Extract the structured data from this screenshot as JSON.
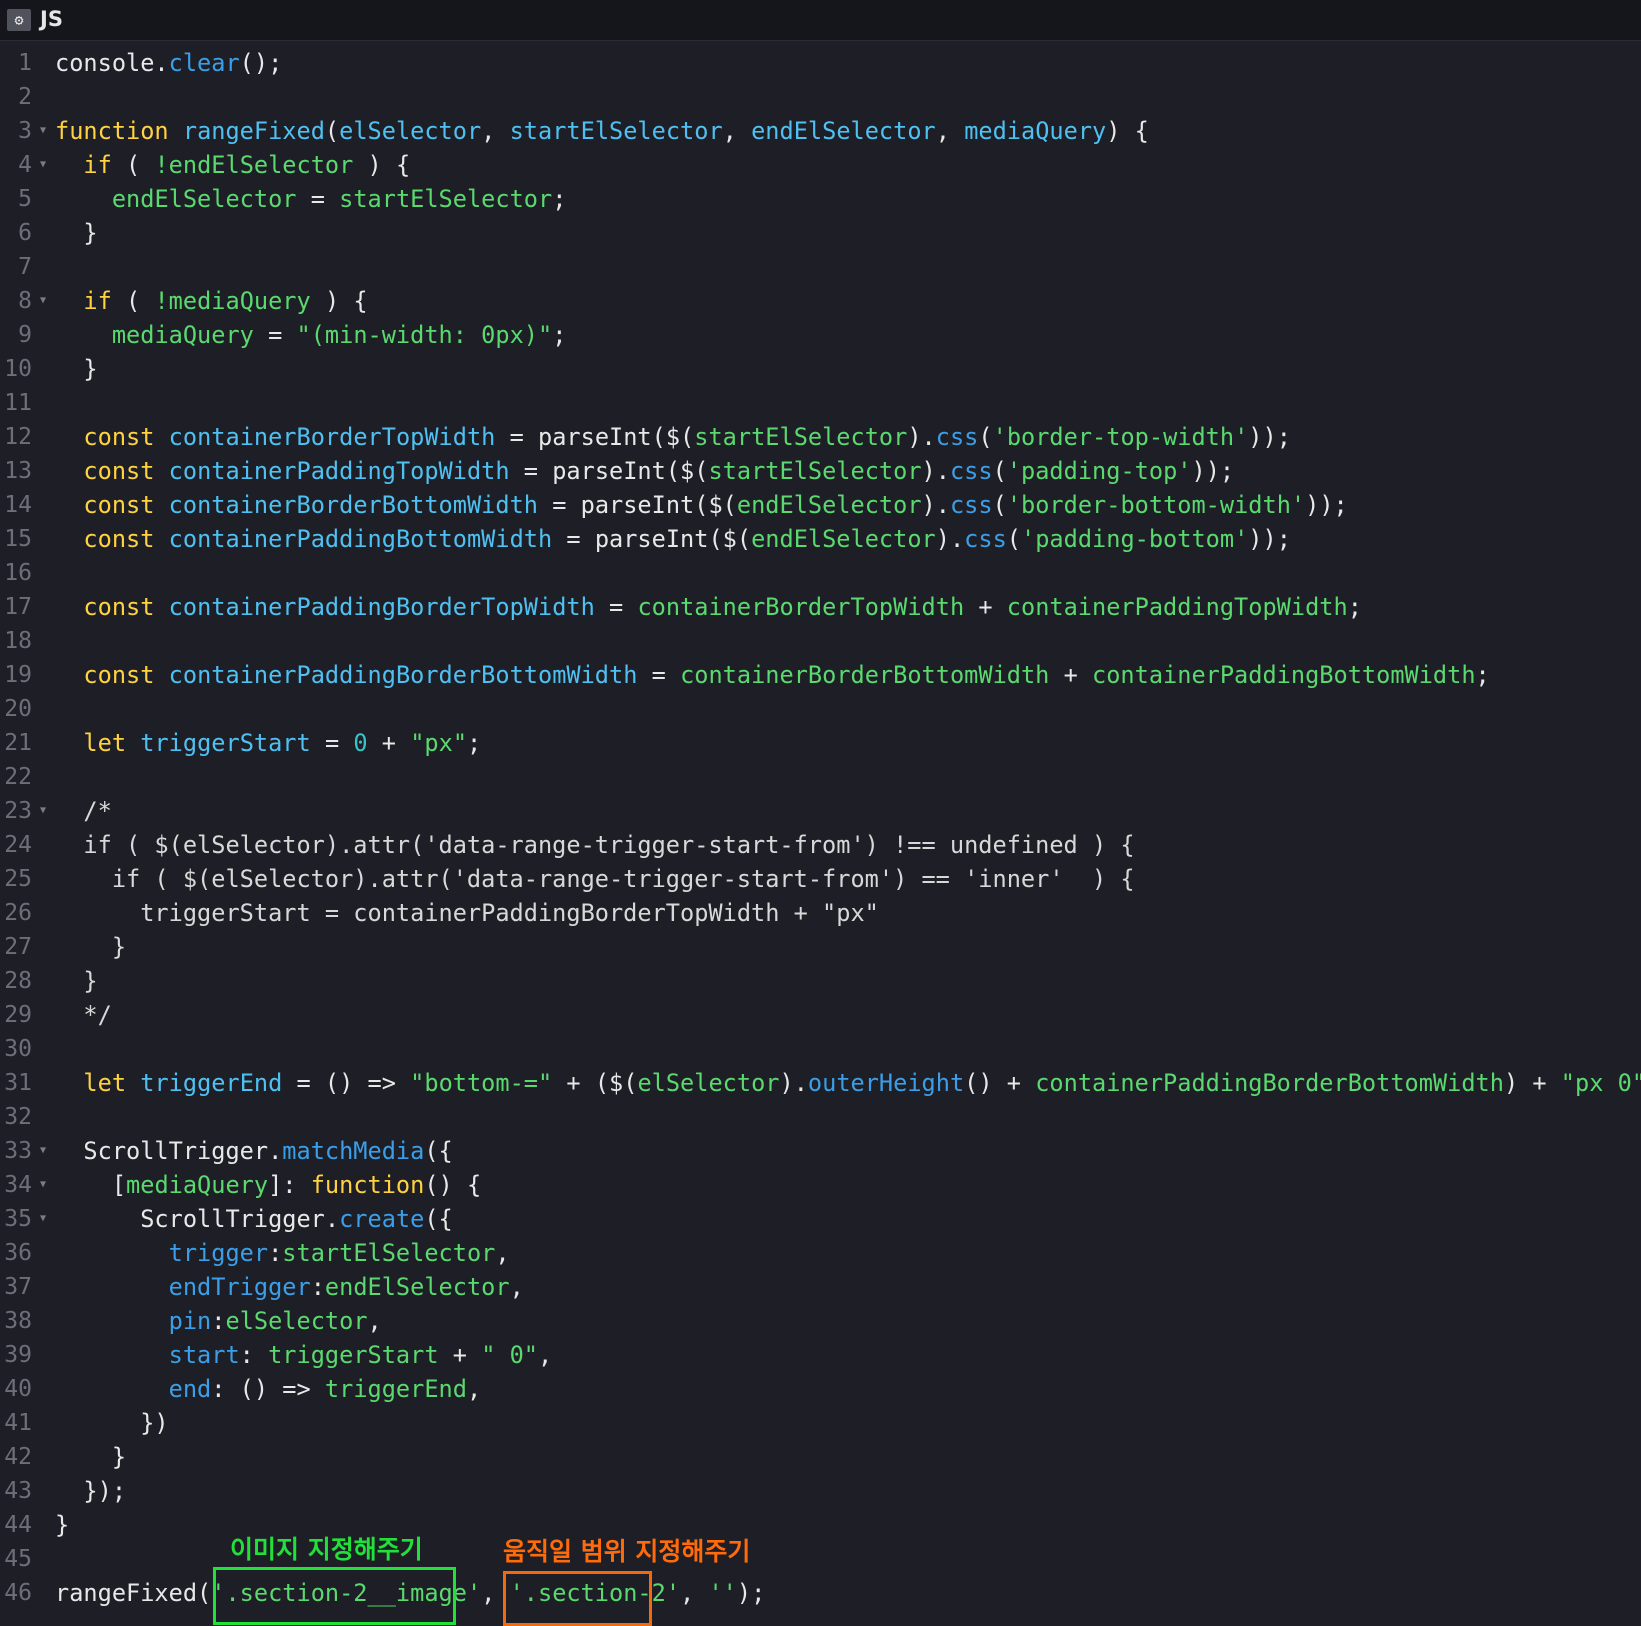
{
  "header": {
    "settings_icon": "gear-icon",
    "language_label": "JS"
  },
  "colors": {
    "keyword": "#ffd23f",
    "definition": "#4ec0f2",
    "variable": "#5ad96f",
    "number": "#39c3c8",
    "property": "#3a9fe8",
    "comment": "#d8d8d8",
    "text": "#e8e8e8",
    "annotation_green": "#22e03a",
    "annotation_orange": "#ff6a0a"
  },
  "code_lines": [
    {
      "n": "1",
      "fold": false,
      "tokens": [
        [
          "txt",
          "console."
        ],
        [
          "prop",
          "clear"
        ],
        [
          "txt",
          "();"
        ]
      ]
    },
    {
      "n": "2",
      "fold": false,
      "tokens": []
    },
    {
      "n": "3",
      "fold": true,
      "tokens": [
        [
          "kw",
          "function"
        ],
        [
          "txt",
          " "
        ],
        [
          "def",
          "rangeFixed"
        ],
        [
          "txt",
          "("
        ],
        [
          "def",
          "elSelector"
        ],
        [
          "txt",
          ", "
        ],
        [
          "def",
          "startElSelector"
        ],
        [
          "txt",
          ", "
        ],
        [
          "def",
          "endElSelector"
        ],
        [
          "txt",
          ", "
        ],
        [
          "def",
          "mediaQuery"
        ],
        [
          "txt",
          ") {"
        ]
      ]
    },
    {
      "n": "4",
      "fold": true,
      "tokens": [
        [
          "txt",
          "  "
        ],
        [
          "kw",
          "if"
        ],
        [
          "txt",
          " ( "
        ],
        [
          "var",
          "!endElSelector"
        ],
        [
          "txt",
          " ) {"
        ]
      ]
    },
    {
      "n": "5",
      "fold": false,
      "tokens": [
        [
          "txt",
          "    "
        ],
        [
          "var",
          "endElSelector"
        ],
        [
          "txt",
          " = "
        ],
        [
          "var",
          "startElSelector"
        ],
        [
          "txt",
          ";"
        ]
      ]
    },
    {
      "n": "6",
      "fold": false,
      "tokens": [
        [
          "txt",
          "  }"
        ]
      ]
    },
    {
      "n": "7",
      "fold": false,
      "tokens": []
    },
    {
      "n": "8",
      "fold": true,
      "tokens": [
        [
          "txt",
          "  "
        ],
        [
          "kw",
          "if"
        ],
        [
          "txt",
          " ( "
        ],
        [
          "var",
          "!mediaQuery"
        ],
        [
          "txt",
          " ) {"
        ]
      ]
    },
    {
      "n": "9",
      "fold": false,
      "tokens": [
        [
          "txt",
          "    "
        ],
        [
          "var",
          "mediaQuery"
        ],
        [
          "txt",
          " = "
        ],
        [
          "str",
          "\"(min-width: 0px)\""
        ],
        [
          "txt",
          ";"
        ]
      ]
    },
    {
      "n": "10",
      "fold": false,
      "tokens": [
        [
          "txt",
          "  }"
        ]
      ]
    },
    {
      "n": "11",
      "fold": false,
      "tokens": []
    },
    {
      "n": "12",
      "fold": false,
      "tokens": [
        [
          "txt",
          "  "
        ],
        [
          "kw",
          "const"
        ],
        [
          "txt",
          " "
        ],
        [
          "def",
          "containerBorderTopWidth"
        ],
        [
          "txt",
          " = parseInt($("
        ],
        [
          "var",
          "startElSelector"
        ],
        [
          "txt",
          ")."
        ],
        [
          "prop",
          "css"
        ],
        [
          "txt",
          "("
        ],
        [
          "str",
          "'border-top-width'"
        ],
        [
          "txt",
          "));"
        ]
      ]
    },
    {
      "n": "13",
      "fold": false,
      "tokens": [
        [
          "txt",
          "  "
        ],
        [
          "kw",
          "const"
        ],
        [
          "txt",
          " "
        ],
        [
          "def",
          "containerPaddingTopWidth"
        ],
        [
          "txt",
          " = parseInt($("
        ],
        [
          "var",
          "startElSelector"
        ],
        [
          "txt",
          ")."
        ],
        [
          "prop",
          "css"
        ],
        [
          "txt",
          "("
        ],
        [
          "str",
          "'padding-top'"
        ],
        [
          "txt",
          "));"
        ]
      ]
    },
    {
      "n": "14",
      "fold": false,
      "tokens": [
        [
          "txt",
          "  "
        ],
        [
          "kw",
          "const"
        ],
        [
          "txt",
          " "
        ],
        [
          "def",
          "containerBorderBottomWidth"
        ],
        [
          "txt",
          " = parseInt($("
        ],
        [
          "var",
          "endElSelector"
        ],
        [
          "txt",
          ")."
        ],
        [
          "prop",
          "css"
        ],
        [
          "txt",
          "("
        ],
        [
          "str",
          "'border-bottom-width'"
        ],
        [
          "txt",
          "));"
        ]
      ]
    },
    {
      "n": "15",
      "fold": false,
      "tokens": [
        [
          "txt",
          "  "
        ],
        [
          "kw",
          "const"
        ],
        [
          "txt",
          " "
        ],
        [
          "def",
          "containerPaddingBottomWidth"
        ],
        [
          "txt",
          " = parseInt($("
        ],
        [
          "var",
          "endElSelector"
        ],
        [
          "txt",
          ")."
        ],
        [
          "prop",
          "css"
        ],
        [
          "txt",
          "("
        ],
        [
          "str",
          "'padding-bottom'"
        ],
        [
          "txt",
          "));"
        ]
      ]
    },
    {
      "n": "16",
      "fold": false,
      "tokens": []
    },
    {
      "n": "17",
      "fold": false,
      "tokens": [
        [
          "txt",
          "  "
        ],
        [
          "kw",
          "const"
        ],
        [
          "txt",
          " "
        ],
        [
          "def",
          "containerPaddingBorderTopWidth"
        ],
        [
          "txt",
          " = "
        ],
        [
          "var",
          "containerBorderTopWidth"
        ],
        [
          "txt",
          " + "
        ],
        [
          "var",
          "containerPaddingTopWidth"
        ],
        [
          "txt",
          ";"
        ]
      ]
    },
    {
      "n": "18",
      "fold": false,
      "tokens": []
    },
    {
      "n": "19",
      "fold": false,
      "tokens": [
        [
          "txt",
          "  "
        ],
        [
          "kw",
          "const"
        ],
        [
          "txt",
          " "
        ],
        [
          "def",
          "containerPaddingBorderBottomWidth"
        ],
        [
          "txt",
          " = "
        ],
        [
          "var",
          "containerBorderBottomWidth"
        ],
        [
          "txt",
          " + "
        ],
        [
          "var",
          "containerPaddingBottomWidth"
        ],
        [
          "txt",
          ";"
        ]
      ]
    },
    {
      "n": "20",
      "fold": false,
      "tokens": []
    },
    {
      "n": "21",
      "fold": false,
      "tokens": [
        [
          "txt",
          "  "
        ],
        [
          "kw",
          "let"
        ],
        [
          "txt",
          " "
        ],
        [
          "def",
          "triggerStart"
        ],
        [
          "txt",
          " = "
        ],
        [
          "num",
          "0"
        ],
        [
          "txt",
          " + "
        ],
        [
          "str",
          "\"px\""
        ],
        [
          "txt",
          ";"
        ]
      ]
    },
    {
      "n": "22",
      "fold": false,
      "tokens": []
    },
    {
      "n": "23",
      "fold": true,
      "tokens": [
        [
          "com",
          "  /*"
        ]
      ]
    },
    {
      "n": "24",
      "fold": false,
      "tokens": [
        [
          "com",
          "  if ( $(elSelector).attr('data-range-trigger-start-from') !== undefined ) {"
        ]
      ]
    },
    {
      "n": "25",
      "fold": false,
      "tokens": [
        [
          "com",
          "    if ( $(elSelector).attr('data-range-trigger-start-from') == 'inner'  ) {"
        ]
      ]
    },
    {
      "n": "26",
      "fold": false,
      "tokens": [
        [
          "com",
          "      triggerStart = containerPaddingBorderTopWidth + \"px\""
        ]
      ]
    },
    {
      "n": "27",
      "fold": false,
      "tokens": [
        [
          "com",
          "    }"
        ]
      ]
    },
    {
      "n": "28",
      "fold": false,
      "tokens": [
        [
          "com",
          "  }"
        ]
      ]
    },
    {
      "n": "29",
      "fold": false,
      "tokens": [
        [
          "com",
          "  */"
        ]
      ]
    },
    {
      "n": "30",
      "fold": false,
      "tokens": []
    },
    {
      "n": "31",
      "fold": false,
      "tokens": [
        [
          "txt",
          "  "
        ],
        [
          "kw",
          "let"
        ],
        [
          "txt",
          " "
        ],
        [
          "def",
          "triggerEnd"
        ],
        [
          "txt",
          " = () => "
        ],
        [
          "str",
          "\"bottom-=\""
        ],
        [
          "txt",
          " + ($("
        ],
        [
          "var",
          "elSelector"
        ],
        [
          "txt",
          ")."
        ],
        [
          "prop",
          "outerHeight"
        ],
        [
          "txt",
          "() + "
        ],
        [
          "var",
          "containerPaddingBorderBottomWidth"
        ],
        [
          "txt",
          ") + "
        ],
        [
          "str",
          "\"px 0\""
        ],
        [
          "txt",
          ";"
        ]
      ]
    },
    {
      "n": "32",
      "fold": false,
      "tokens": []
    },
    {
      "n": "33",
      "fold": true,
      "tokens": [
        [
          "txt",
          "  ScrollTrigger."
        ],
        [
          "prop",
          "matchMedia"
        ],
        [
          "txt",
          "({"
        ]
      ]
    },
    {
      "n": "34",
      "fold": true,
      "tokens": [
        [
          "txt",
          "    ["
        ],
        [
          "var",
          "mediaQuery"
        ],
        [
          "txt",
          "]: "
        ],
        [
          "kw",
          "function"
        ],
        [
          "txt",
          "() {"
        ]
      ]
    },
    {
      "n": "35",
      "fold": true,
      "tokens": [
        [
          "txt",
          "      ScrollTrigger."
        ],
        [
          "prop",
          "create"
        ],
        [
          "txt",
          "({"
        ]
      ]
    },
    {
      "n": "36",
      "fold": false,
      "tokens": [
        [
          "txt",
          "        "
        ],
        [
          "prop",
          "trigger"
        ],
        [
          "txt",
          ":"
        ],
        [
          "var",
          "startElSelector"
        ],
        [
          "txt",
          ","
        ]
      ]
    },
    {
      "n": "37",
      "fold": false,
      "tokens": [
        [
          "txt",
          "        "
        ],
        [
          "prop",
          "endTrigger"
        ],
        [
          "txt",
          ":"
        ],
        [
          "var",
          "endElSelector"
        ],
        [
          "txt",
          ","
        ]
      ]
    },
    {
      "n": "38",
      "fold": false,
      "tokens": [
        [
          "txt",
          "        "
        ],
        [
          "prop",
          "pin"
        ],
        [
          "txt",
          ":"
        ],
        [
          "var",
          "elSelector"
        ],
        [
          "txt",
          ","
        ]
      ]
    },
    {
      "n": "39",
      "fold": false,
      "tokens": [
        [
          "txt",
          "        "
        ],
        [
          "prop",
          "start"
        ],
        [
          "txt",
          ": "
        ],
        [
          "var",
          "triggerStart"
        ],
        [
          "txt",
          " + "
        ],
        [
          "str",
          "\" 0\""
        ],
        [
          "txt",
          ","
        ]
      ]
    },
    {
      "n": "40",
      "fold": false,
      "tokens": [
        [
          "txt",
          "        "
        ],
        [
          "prop",
          "end"
        ],
        [
          "txt",
          ": () => "
        ],
        [
          "var",
          "triggerEnd"
        ],
        [
          "txt",
          ","
        ]
      ]
    },
    {
      "n": "41",
      "fold": false,
      "tokens": [
        [
          "txt",
          "      })"
        ]
      ]
    },
    {
      "n": "42",
      "fold": false,
      "tokens": [
        [
          "txt",
          "    }"
        ]
      ]
    },
    {
      "n": "43",
      "fold": false,
      "tokens": [
        [
          "txt",
          "  });"
        ]
      ]
    },
    {
      "n": "44",
      "fold": false,
      "tokens": [
        [
          "txt",
          "}"
        ]
      ]
    },
    {
      "n": "45",
      "fold": false,
      "tokens": []
    },
    {
      "n": "46",
      "fold": false,
      "tokens": [
        [
          "txt",
          "rangeFixed("
        ],
        [
          "str",
          "'.section-2__image'"
        ],
        [
          "txt",
          ", "
        ],
        [
          "str",
          "'.section-2'"
        ],
        [
          "txt",
          ", "
        ],
        [
          "str",
          "''"
        ],
        [
          "txt",
          ");"
        ]
      ]
    }
  ],
  "annotations": {
    "image_label": "이미지 지정해주기",
    "range_label": "움직일 범위 지정해주기"
  }
}
